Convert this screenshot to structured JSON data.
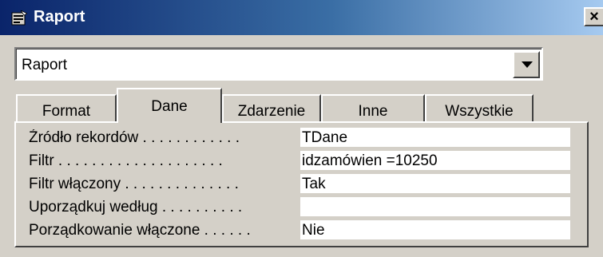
{
  "window": {
    "title": "Raport",
    "close_symbol": "×",
    "icon": "property-sheet-icon"
  },
  "selector": {
    "value": "Raport",
    "arrow_icon": "dropdown-arrow-icon"
  },
  "tabs": [
    {
      "label": "Format",
      "active": false
    },
    {
      "label": "Dane",
      "active": true
    },
    {
      "label": "Zdarzenie",
      "active": false
    },
    {
      "label": "Inne",
      "active": false
    },
    {
      "label": "Wszystkie",
      "active": false
    }
  ],
  "properties": [
    {
      "label": "Źródło rekordów . . . . . . . . . . . .",
      "value": "TDane"
    },
    {
      "label": "Filtr . . . . . . . . . . . . . . . . . . . .",
      "value": "idzamówien =10250"
    },
    {
      "label": "Filtr włączony . . . . . . . . . . . . . .",
      "value": "Tak"
    },
    {
      "label": "Uporządkuj według . . . . . . . . . .",
      "value": ""
    },
    {
      "label": "Porządkowanie włączone . . . . . .",
      "value": "Nie"
    }
  ]
}
